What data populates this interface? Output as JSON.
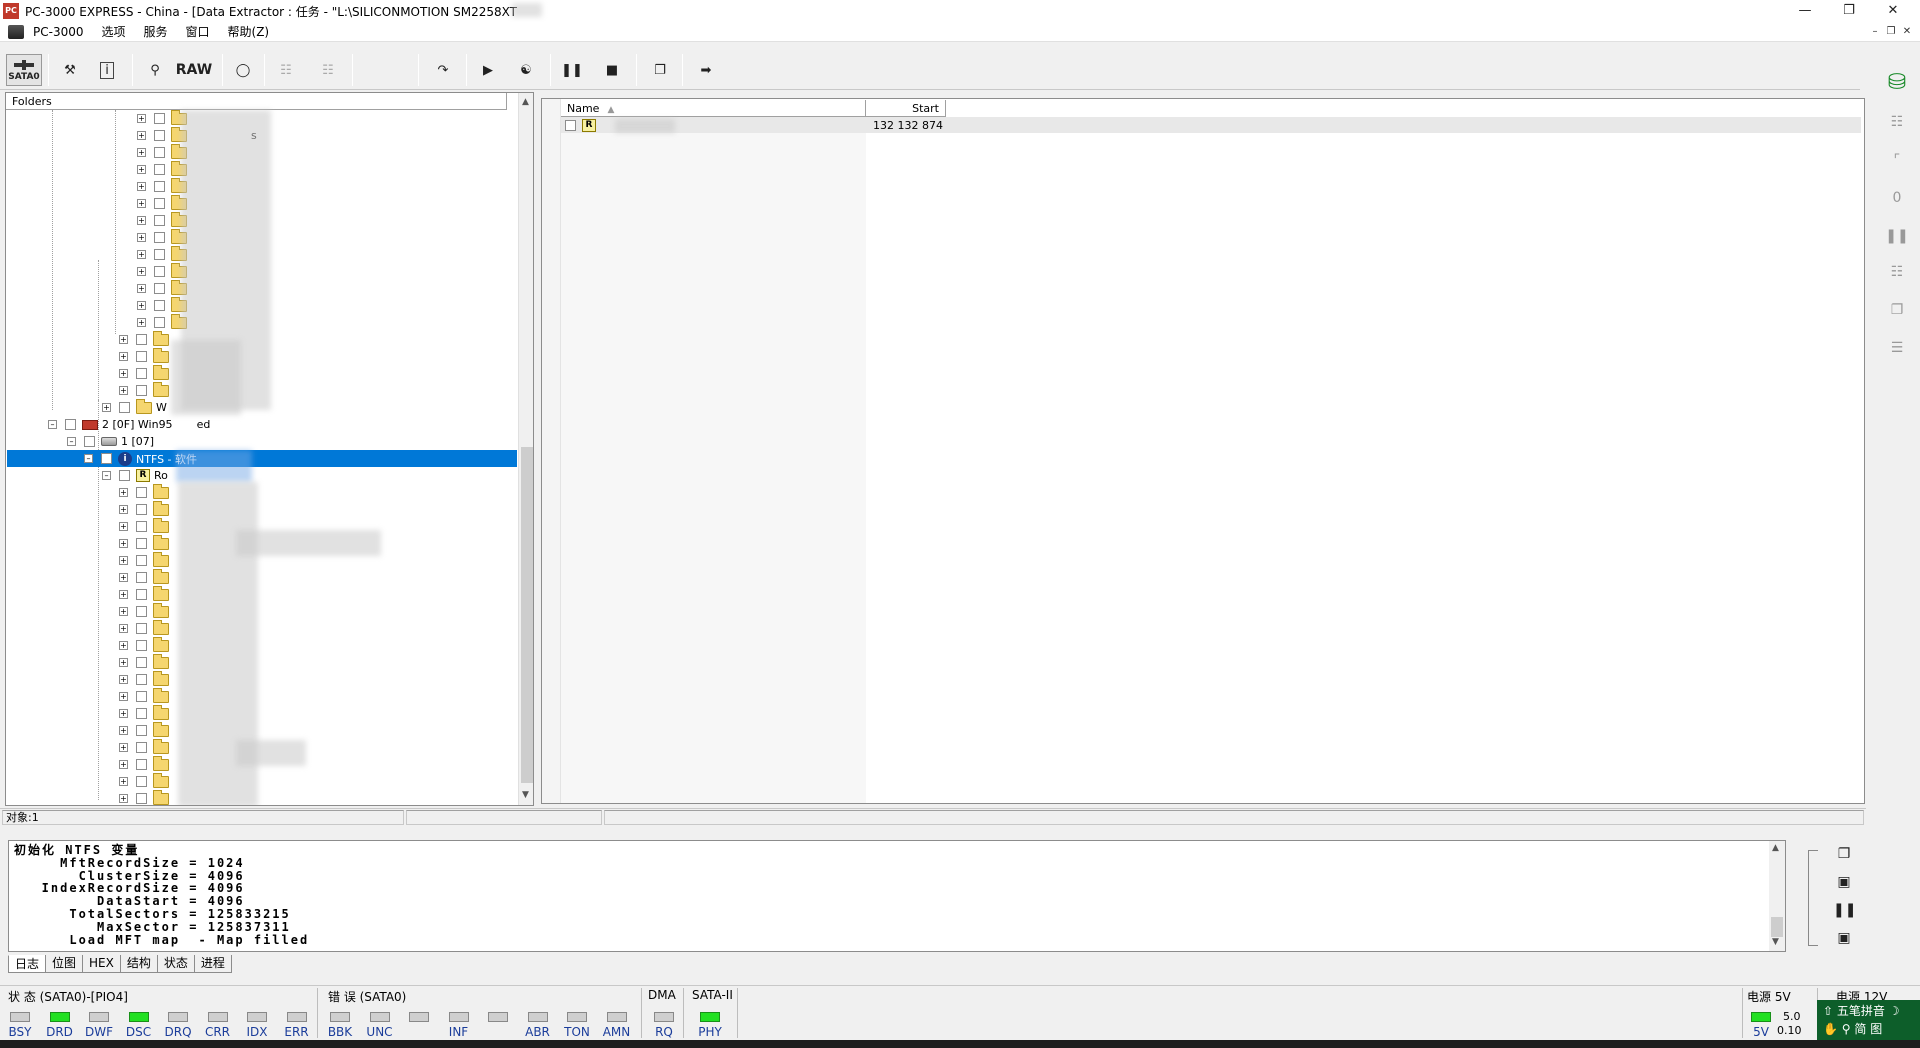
{
  "window": {
    "title": "PC-3000 EXPRESS - China - [Data Extractor : 任务 - \"L:\\SILICONMOTION SM2258XT",
    "app_icon": "PC"
  },
  "menu": [
    "PC-3000",
    "选项",
    "服务",
    "窗口",
    "帮助(Z)"
  ],
  "toolbar": {
    "sata_label": "SATA0",
    "raw_label": "RAW"
  },
  "tree": {
    "header": "Folders",
    "partition_label": "2 [0F] Win95",
    "partition_suffix": "ed",
    "sub_label": "1 [07]",
    "ntfs_label": "NTFS - 软件",
    "root_label": "Ro",
    "w_label": "W",
    "top_item_suffix": "s"
  },
  "list": {
    "columns": [
      "Name",
      "Start"
    ],
    "rows": [
      {
        "name": "",
        "start": "132 132 874"
      }
    ]
  },
  "status": {
    "objects": "对象:1"
  },
  "log": {
    "text": "初始化 NTFS 变量\n     MftRecordSize = 1024\n       ClusterSize = 4096\n   IndexRecordSize = 4096\n         DataStart = 4096\n      TotalSectors = 125833215\n         MaxSector = 125837311\n      Load MFT map  - Map filled"
  },
  "tabs": [
    "日志",
    "位图",
    "HEX",
    "结构",
    "状态",
    "进程"
  ],
  "state_group": {
    "title": "状 态 (SATA0)-[PIO4]",
    "leds": [
      {
        "label": "BSY",
        "on": false
      },
      {
        "label": "DRD",
        "on": true
      },
      {
        "label": "DWF",
        "on": false
      },
      {
        "label": "DSC",
        "on": true
      },
      {
        "label": "DRQ",
        "on": false
      },
      {
        "label": "CRR",
        "on": false
      },
      {
        "label": "IDX",
        "on": false
      },
      {
        "label": "ERR",
        "on": false
      }
    ]
  },
  "error_group": {
    "title": "错 误 (SATA0)",
    "leds": [
      {
        "label": "BBK",
        "on": false
      },
      {
        "label": "UNC",
        "on": false
      },
      {
        "label": "",
        "on": false
      },
      {
        "label": "INF",
        "on": false
      },
      {
        "label": "",
        "on": false
      },
      {
        "label": "ABR",
        "on": false
      },
      {
        "label": "TON",
        "on": false
      },
      {
        "label": "AMN",
        "on": false
      }
    ]
  },
  "dma_group": {
    "title": "DMA",
    "led": {
      "label": "RQ",
      "on": false
    }
  },
  "sata_group": {
    "title": "SATA-II",
    "led": {
      "label": "PHY",
      "on": true
    }
  },
  "power": {
    "title_5v": "电源 5V",
    "title_12v": "电源 12V",
    "led_label": "5V",
    "value_a": "5.0",
    "value_b": "0.10"
  },
  "ime": {
    "label": "五笔拼音",
    "row2": "简 图"
  }
}
